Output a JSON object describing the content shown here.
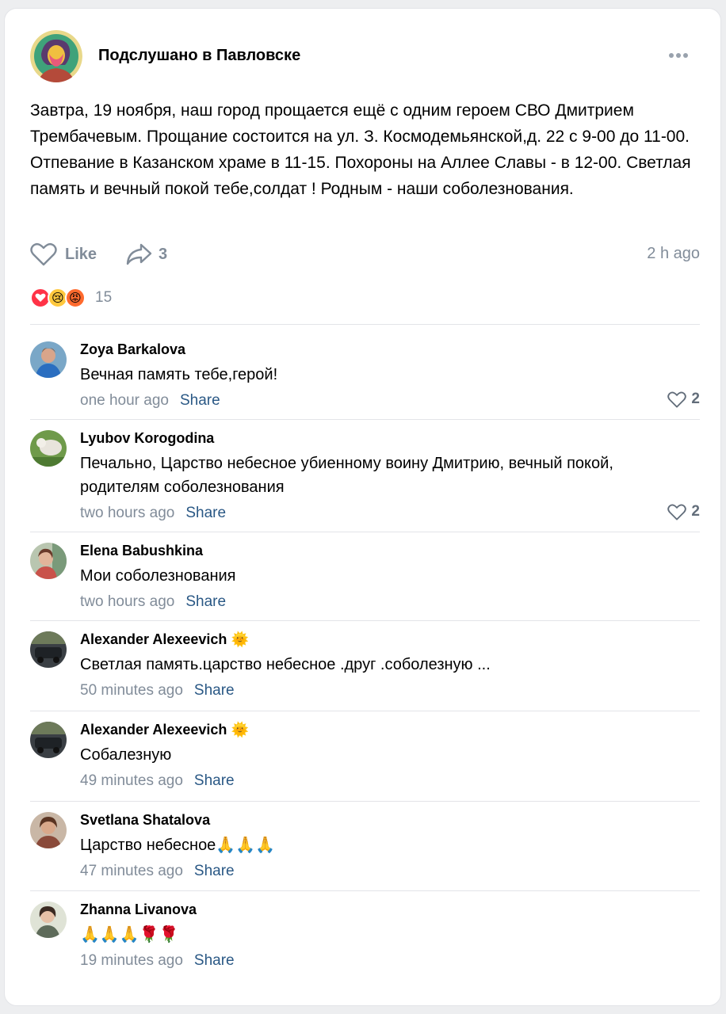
{
  "post": {
    "group_name": "Подслушано в Павловске",
    "text": "Завтра, 19 ноября, наш город прощается ещё с одним героем СВО Дмитрием Трембачевым. Прощание состоится на ул. З. Космодемьянской,д. 22 с 9-00 до 11-00. Отпевание в Казанском храме в 11-15. Похороны на Аллее Славы - в 12-00. Светлая память и вечный покой тебе,солдат ! Родным - наши соболезнования.",
    "like_label": "Like",
    "share_count": "3",
    "time": "2 h ago",
    "reactions": [
      "heart-reaction-icon",
      "crying-reaction-icon",
      "angry-reaction-icon"
    ],
    "reaction_count": "15"
  },
  "comments": [
    {
      "author": "Zoya Barkalova",
      "text": "Вечная память тебе,герой!",
      "time": "one hour ago",
      "share": "Share",
      "likes": "2"
    },
    {
      "author": "Lyubov Korogodina",
      "text": "Печально, Царство небесное убиенному воину Дмитрию, вечный покой, родителям соболезнования",
      "time": "two hours ago",
      "share": "Share",
      "likes": "2"
    },
    {
      "author": "Elena Babushkina",
      "text": "Мои соболезнования",
      "time": "two hours ago",
      "share": "Share"
    },
    {
      "author": "Alexander Alexeevich",
      "author_emoji": "🌞",
      "text": "Светлая память.царство небесное .друг .соболезную ...",
      "time": "50 minutes ago",
      "share": "Share"
    },
    {
      "author": "Alexander Alexeevich",
      "author_emoji": "🌞",
      "text": "Собалезную",
      "time": "49 minutes ago",
      "share": "Share"
    },
    {
      "author": "Svetlana Shatalova",
      "text": "Царство небесное🙏🙏🙏",
      "time": "47 minutes ago",
      "share": "Share"
    },
    {
      "author": "Zhanna Livanova",
      "text": "🙏🙏🙏🌹🌹",
      "time": "19 minutes ago",
      "share": "Share"
    }
  ],
  "colors": {
    "link": "#2a5885",
    "secondary": "#818c99",
    "heart_reaction": "#ff3347"
  }
}
